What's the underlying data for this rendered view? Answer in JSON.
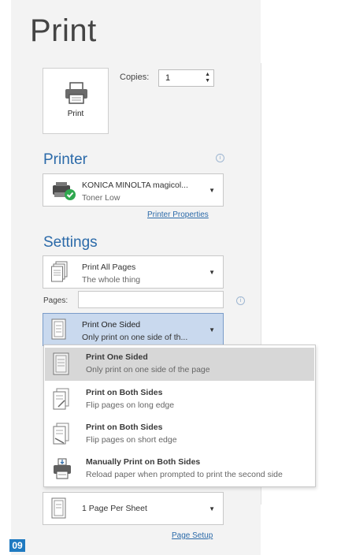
{
  "title": "Print",
  "print_button": {
    "label": "Print",
    "icon": "printer-icon"
  },
  "copies": {
    "label": "Copies:",
    "value": "1"
  },
  "printer": {
    "heading": "Printer",
    "name": "KONICA MINOLTA magicol...",
    "status": "Toner Low",
    "properties_link": "Printer Properties"
  },
  "settings": {
    "heading": "Settings",
    "print_pages": {
      "main": "Print All Pages",
      "sub": "The whole thing"
    },
    "pages_label": "Pages:",
    "pages_value": "",
    "sided": {
      "main": "Print One Sided",
      "sub": "Only print on one side of th..."
    },
    "per_sheet": {
      "main": "1 Page Per Sheet"
    },
    "page_setup_link": "Page Setup"
  },
  "sided_menu": {
    "items": [
      {
        "main": "Print One Sided",
        "sub": "Only print on one side of the page",
        "icon": "one-sided-page-icon",
        "selected": true
      },
      {
        "main": "Print on Both Sides",
        "sub": "Flip pages on long edge",
        "icon": "long-edge-flip-icon",
        "selected": false
      },
      {
        "main": "Print on Both Sides",
        "sub": "Flip pages on short edge",
        "icon": "short-edge-flip-icon",
        "selected": false
      },
      {
        "main": "Manually Print on Both Sides",
        "sub": "Reload paper when prompted to print the second side",
        "icon": "manual-duplex-printer-icon",
        "selected": false
      }
    ]
  },
  "step_badge": "09",
  "colors": {
    "accent": "#2b6aa9",
    "selected_bg": "#c9d9ee",
    "menu_selected": "#d7d7d7",
    "badge": "#1f7ac1",
    "status_ok": "#2fa84f"
  }
}
